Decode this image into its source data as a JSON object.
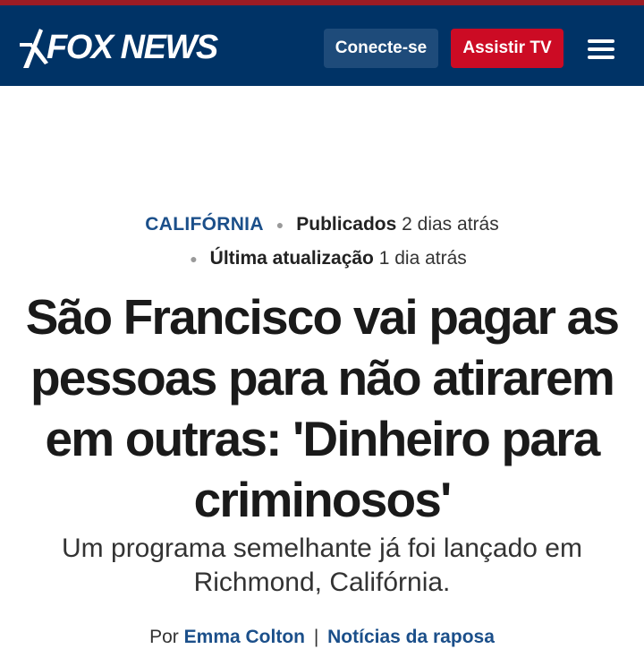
{
  "header": {
    "brand": "FOX NEWS",
    "login_label": "Conecte-se",
    "watch_label": "Assistir TV",
    "menu_icon": "hamburger-menu-icon",
    "colors": {
      "bar": "#003366",
      "accent_top": "#9b1c24",
      "watch_button": "#cc0b24",
      "login_button": "#1e4b7a"
    }
  },
  "article": {
    "category": "CALIFÓRNIA",
    "published_label": "Publicados",
    "published_value": "2 dias atrás",
    "updated_label": "Última atualização",
    "updated_value": "1 dia atrás",
    "headline": "São Francisco vai pagar as pessoas para não atirarem em outras: 'Dinheiro para criminosos'",
    "subheadline": "Um programa semelhante já foi lançado em Richmond, Califórnia.",
    "byline_prefix": "Por",
    "author": "Emma Colton",
    "byline_separator": "|",
    "source": "Notícias da raposa"
  }
}
